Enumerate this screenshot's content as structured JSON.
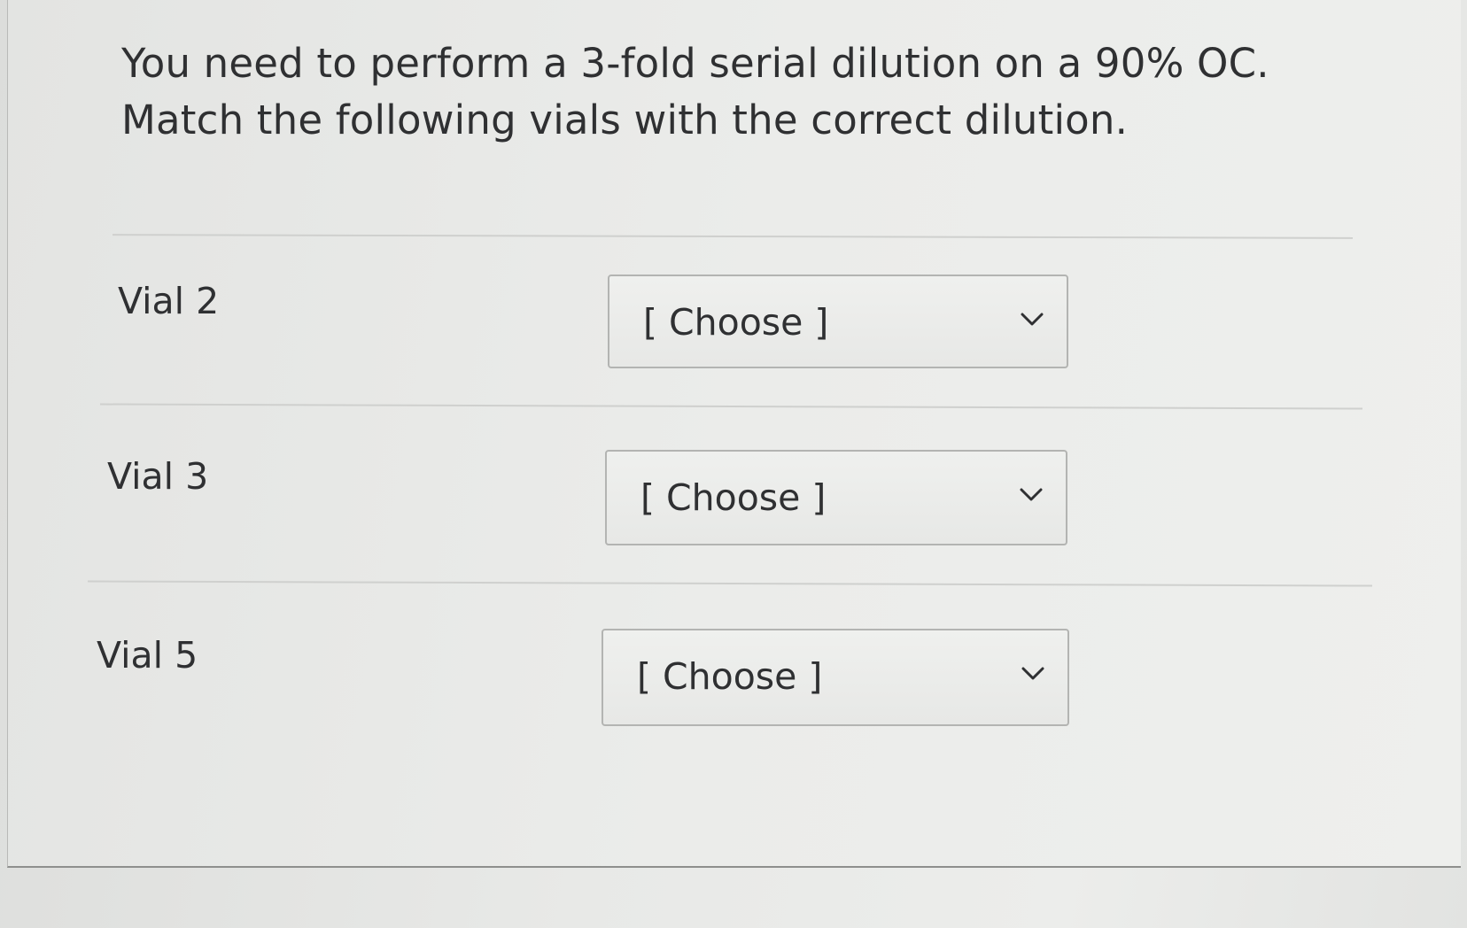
{
  "question": {
    "text": "You need to perform a 3-fold serial dilution on a 90% OC. Match the following vials with the correct dilution."
  },
  "rows": [
    {
      "label": "Vial 2",
      "select_value": "[ Choose ]"
    },
    {
      "label": "Vial 3",
      "select_value": "[ Choose ]"
    },
    {
      "label": "Vial 5",
      "select_value": "[ Choose ]"
    }
  ],
  "icons": {
    "dropdown": "chevron-down-icon"
  },
  "colors": {
    "text": "#2f3032",
    "border": "#b3b4b2",
    "background": "#ebecea"
  }
}
